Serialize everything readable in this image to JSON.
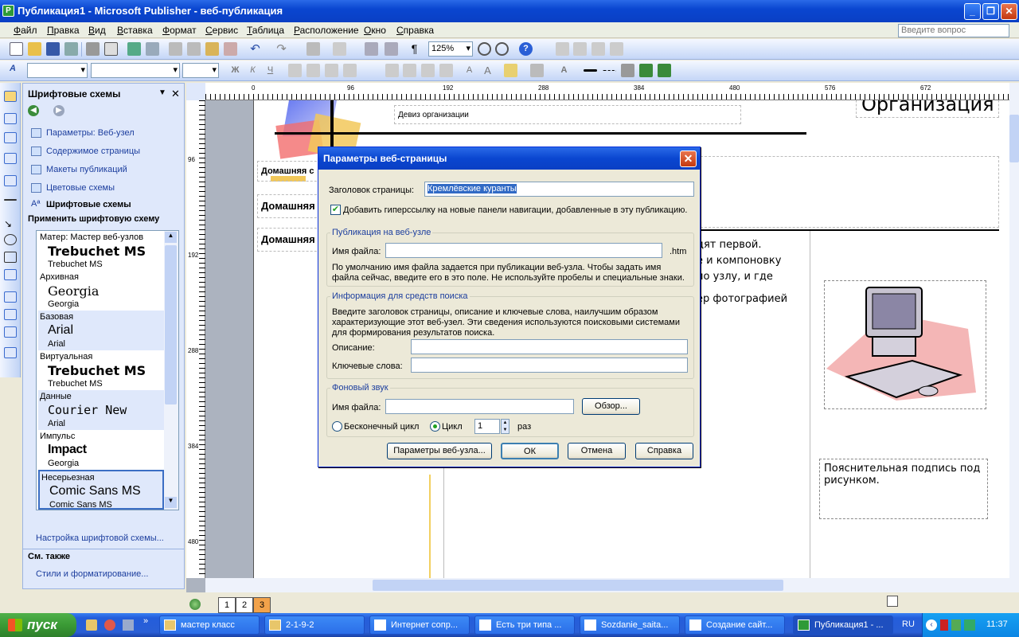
{
  "window": {
    "title": "Публикация1 - Microsoft Publisher - веб-публикация"
  },
  "menu": {
    "items": [
      "Файл",
      "Правка",
      "Вид",
      "Вставка",
      "Формат",
      "Сервис",
      "Таблица",
      "Расположение",
      "Окно",
      "Справка"
    ],
    "help_placeholder": "Введите вопрос"
  },
  "toolbar": {
    "zoom": "125%"
  },
  "taskpane": {
    "title": "Шрифтовые схемы",
    "links": [
      "Параметры: Веб-узел",
      "Содержимое страницы",
      "Макеты публикаций",
      "Цветовые схемы"
    ],
    "active": "Шрифтовые схемы",
    "apply_label": "Применить шрифтовую схему",
    "schemes": [
      {
        "name": "Матер: Мастер веб-узлов",
        "font1": "Trebuchet MS",
        "font2": "Trebuchet MS"
      },
      {
        "name": "Архивная",
        "font1": "Georgia",
        "font2": "Georgia"
      },
      {
        "name": "Базовая",
        "font1": "Arial",
        "font2": "Arial"
      },
      {
        "name": "Виртуальная",
        "font1": "Trebuchet MS",
        "font2": "Trebuchet MS"
      },
      {
        "name": "Данные",
        "font1": "Courier New",
        "font2": "Arial"
      },
      {
        "name": "Импульс",
        "font1": "Impact",
        "font2": "Georgia"
      },
      {
        "name": "Несерьезная",
        "font1": "Comic Sans MS",
        "font2": "Comic Sans MS"
      }
    ],
    "customize_link": "Настройка шрифтовой схемы...",
    "see_also": "См. также",
    "styles_link": "Стили и форматирование..."
  },
  "ruler": {
    "h": [
      "0",
      "96",
      "192",
      "288",
      "384",
      "480",
      "576",
      "672"
    ],
    "v": [
      "96",
      "192",
      "288",
      "384",
      "480"
    ]
  },
  "page": {
    "motto": "Девиз организации",
    "org": "Организация",
    "nav1": "Домашняя с",
    "nav2": "Домашняя",
    "nav3": "Домашняя",
    "body_lines": [
      "дят первой.",
      "е и компоновку",
      "по узлу, и где",
      "",
      "ер фотографией"
    ],
    "caption": "Пояснительная подпись под рисунком."
  },
  "dialog": {
    "title": "Параметры веб-страницы",
    "page_title_label": "Заголовок страницы:",
    "page_title_value": "Кремлёвские куранты",
    "add_link_label": "Добавить гиперссылку на новые панели навигации, добавленные в эту публикацию.",
    "pub_group": "Публикация на веб-узле",
    "filename_label": "Имя файла:",
    "ext": ".htm",
    "pub_note": "По умолчанию имя файла задается при публикации веб-узла. Чтобы задать имя файла сейчас, введите его в это поле. Не используйте пробелы и специальные знаки.",
    "search_group": "Информация для средств поиска",
    "search_note": "Введите заголовок страницы, описание и ключевые слова, наилучшим образом характеризующие этот веб-узел. Эти сведения используются поисковыми системами для формирования результатов поиска.",
    "desc_label": "Описание:",
    "keywords_label": "Ключевые слова:",
    "sound_group": "Фоновый звук",
    "sound_file_label": "Имя файла:",
    "browse": "Обзор...",
    "loop_infinite": "Бесконечный цикл",
    "loop": "Цикл",
    "loop_count": "1",
    "times": "раз",
    "btn_site": "Параметры веб-узла...",
    "btn_ok": "ОК",
    "btn_cancel": "Отмена",
    "btn_help": "Справка"
  },
  "status": {
    "pages": [
      "1",
      "2",
      "3"
    ]
  },
  "taskbar": {
    "start": "пуск",
    "tasks": [
      "мастер класс",
      "2-1-9-2",
      "Интернет сопр...",
      "Есть три типа ...",
      "Sozdanie_saita...",
      "Создание сайт...",
      "Публикация1 - ..."
    ],
    "lang": "RU",
    "time": "11:37"
  }
}
